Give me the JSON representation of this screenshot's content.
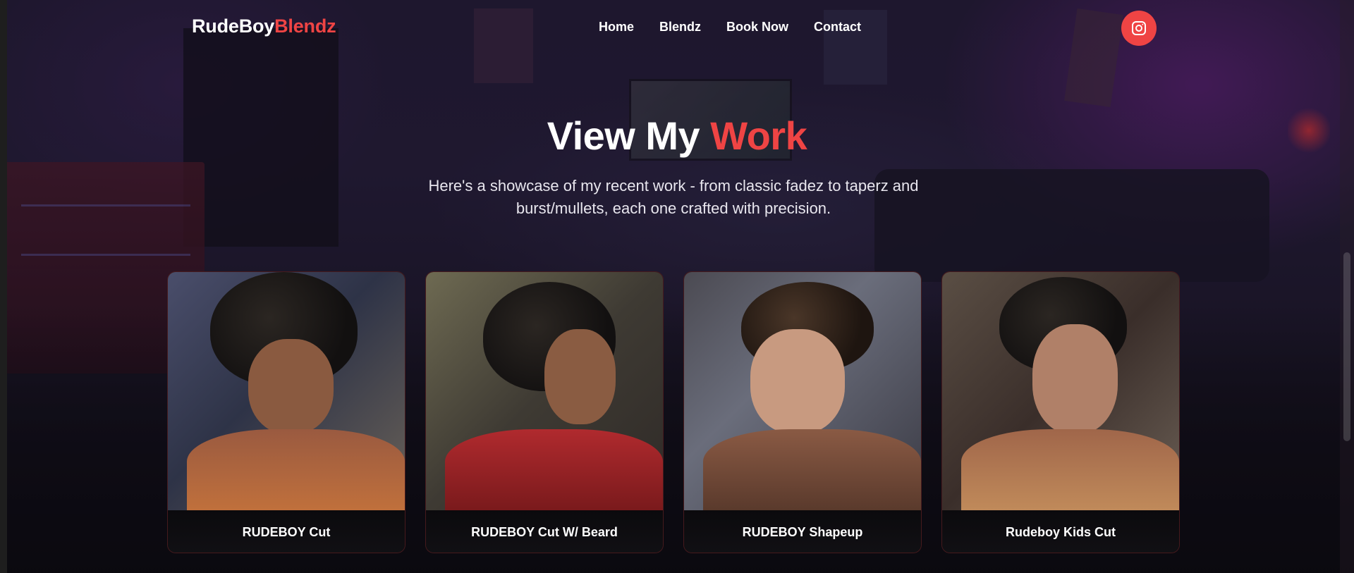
{
  "brand": {
    "name_part1": "RudeBoy",
    "name_part2": "Blendz"
  },
  "nav": {
    "items": [
      {
        "label": "Home"
      },
      {
        "label": "Blendz"
      },
      {
        "label": "Book Now"
      },
      {
        "label": "Contact"
      }
    ],
    "social_icon": "instagram-icon"
  },
  "hero": {
    "title_part1": "View My",
    "title_part2": "Work",
    "subtitle": "Here's a showcase of my recent work - from classic fadez to taperz and burst/mullets, each one crafted with precision."
  },
  "gallery": {
    "items": [
      {
        "caption": "RUDEBOY Cut"
      },
      {
        "caption": "RUDEBOY Cut W/ Beard"
      },
      {
        "caption": "RUDEBOY Shapeup"
      },
      {
        "caption": "Rudeboy Kids Cut"
      }
    ]
  },
  "colors": {
    "accent": "#ef4444",
    "text": "#ffffff",
    "card_bg": "#0e0c10"
  }
}
